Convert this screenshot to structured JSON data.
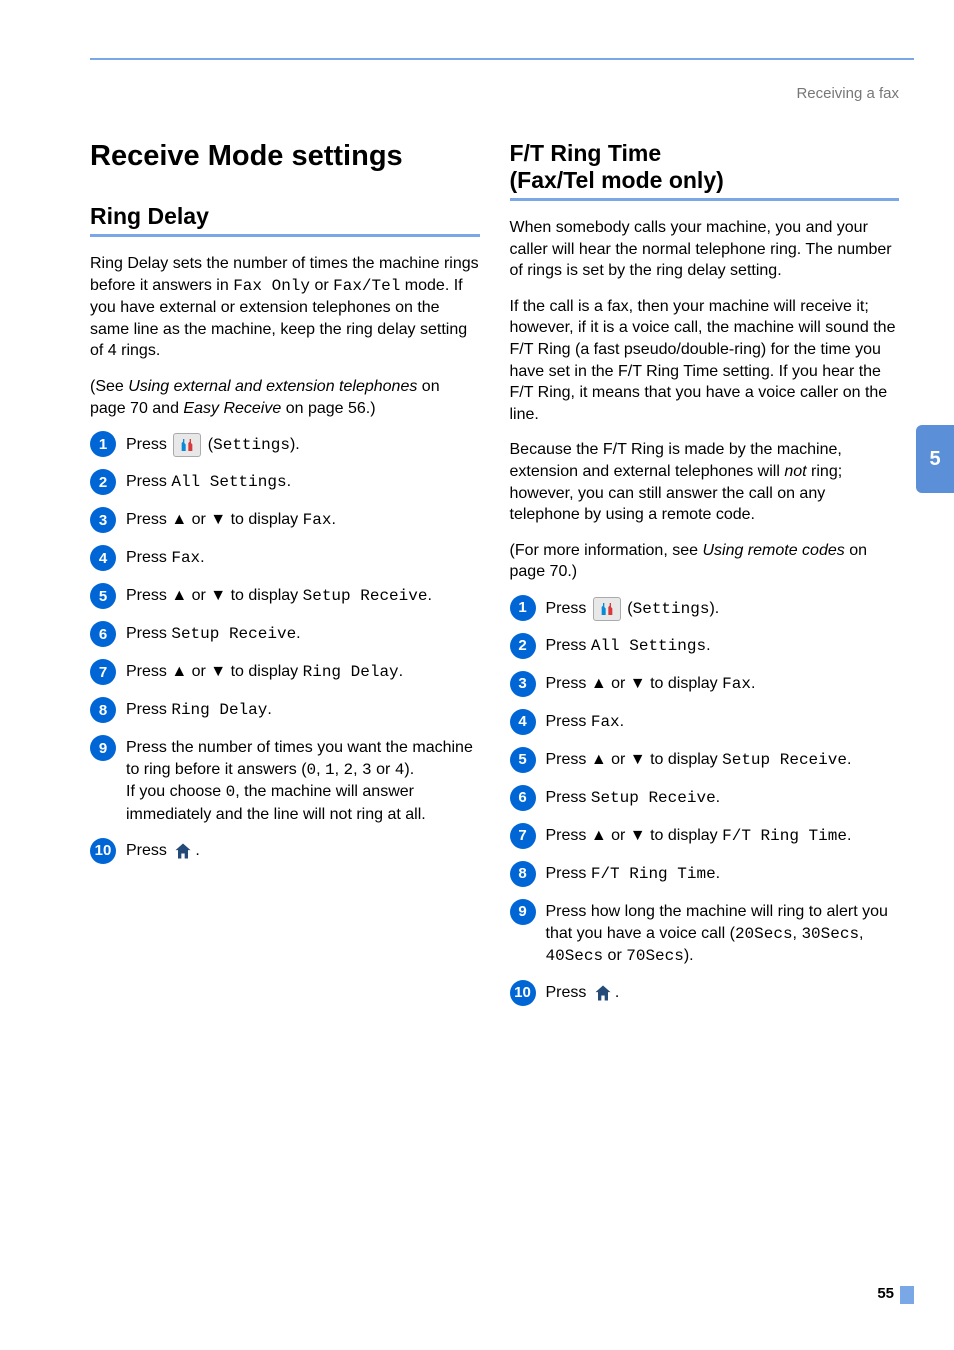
{
  "header": {
    "chapter": "Receiving a fax",
    "tab_label": "5",
    "page_number": "55"
  },
  "left": {
    "title": "Receive Mode settings",
    "subtitle": "Ring Delay",
    "p1_a": "Ring Delay sets the number of times the machine rings before it answers in ",
    "p1_mono1": "Fax Only",
    "p1_b": " or ",
    "p1_mono2": "Fax/Tel",
    "p1_c": " mode. If you have external or extension telephones on the same line as the machine, keep the ring delay setting of 4 rings.",
    "p2_a": "(See ",
    "p2_i1": "Using external and extension telephones",
    "p2_b": " on page 70 and ",
    "p2_i2": "Easy Receive",
    "p2_c": " on page 56.)",
    "steps": {
      "s1_a": "Press ",
      "s1_b": " (",
      "s1_mono": "Settings",
      "s1_c": ").",
      "s2_a": "Press ",
      "s2_mono": "All Settings",
      "s2_b": ".",
      "s3_a": "Press ▲ or ▼ to display ",
      "s3_mono": "Fax",
      "s3_b": ".",
      "s4_a": "Press ",
      "s4_mono": "Fax",
      "s4_b": ".",
      "s5_a": "Press ▲ or ▼ to display ",
      "s5_mono": "Setup Receive",
      "s5_b": ".",
      "s6_a": "Press ",
      "s6_mono": "Setup Receive",
      "s6_b": ".",
      "s7_a": "Press ▲ or ▼ to display ",
      "s7_mono": "Ring Delay",
      "s7_b": ".",
      "s8_a": "Press ",
      "s8_mono": "Ring Delay",
      "s8_b": ".",
      "s9_a": "Press the number of times you want the machine to ring before it answers (",
      "s9_m1": "0",
      "s9_b": ", ",
      "s9_m2": "1",
      "s9_c": ", ",
      "s9_m3": "2",
      "s9_d": ", ",
      "s9_m4": "3",
      "s9_e": " or ",
      "s9_m5": "4",
      "s9_f": ").",
      "s9_line2a": "If you choose ",
      "s9_line2m": "0",
      "s9_line2b": ", the machine will answer immediately and the line will not ring at all.",
      "s10_a": "Press ",
      "s10_b": "."
    }
  },
  "right": {
    "subtitle_line1": "F/T Ring Time",
    "subtitle_line2": "(Fax/Tel mode only)",
    "p1": "When somebody calls your machine, you and your caller will hear the normal telephone ring. The number of rings is set by the ring delay setting.",
    "p2": "If the call is a fax, then your machine will receive it; however, if it is a voice call, the machine will sound the F/T Ring (a fast pseudo/double-ring) for the time you have set in the F/T Ring Time setting. If you hear the F/T Ring, it means that you have a voice caller on the line.",
    "p3_a": "Because the F/T Ring is made by the machine, extension and external telephones will ",
    "p3_i": "not",
    "p3_b": " ring; however, you can still answer the call on any telephone by using a remote code.",
    "p4_a": "(For more information, see ",
    "p4_i": "Using remote codes",
    "p4_b": " on page 70.)",
    "steps": {
      "s1_a": "Press ",
      "s1_b": " (",
      "s1_mono": "Settings",
      "s1_c": ").",
      "s2_a": "Press ",
      "s2_mono": "All Settings",
      "s2_b": ".",
      "s3_a": "Press ▲ or ▼ to display ",
      "s3_mono": "Fax",
      "s3_b": ".",
      "s4_a": "Press ",
      "s4_mono": "Fax",
      "s4_b": ".",
      "s5_a": "Press ▲ or ▼ to display ",
      "s5_mono": "Setup Receive",
      "s5_b": ".",
      "s6_a": "Press ",
      "s6_mono": "Setup Receive",
      "s6_b": ".",
      "s7_a": "Press ▲ or ▼ to display ",
      "s7_mono": "F/T Ring Time",
      "s7_b": ".",
      "s8_a": "Press ",
      "s8_mono": "F/T Ring Time",
      "s8_b": ".",
      "s9_a": "Press how long the machine will ring to alert you that you have a voice call (",
      "s9_m1": "20Secs",
      "s9_b": ", ",
      "s9_m2": "30Secs",
      "s9_c": ", ",
      "s9_m3": "40Secs",
      "s9_d": " or ",
      "s9_m4": "70Secs",
      "s9_e": ").",
      "s10_a": "Press ",
      "s10_b": "."
    }
  }
}
